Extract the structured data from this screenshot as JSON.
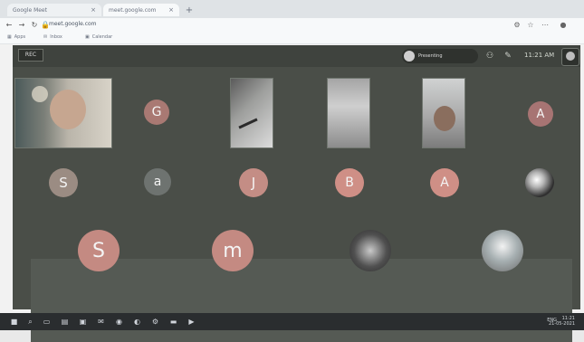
{
  "browser": {
    "tabs": [
      {
        "label": "Google Meet",
        "active": false
      },
      {
        "label": "meet.google.com",
        "active": true
      }
    ],
    "new_tab_icon": "plus-icon",
    "url": "meet.google.com",
    "bookmarks": [
      "Apps",
      "Inbox",
      "Calendar"
    ]
  },
  "meeting": {
    "rec_label": "REC",
    "presenter_label": "Presenting",
    "clock": "11:21 AM",
    "participants": [
      {
        "type": "video",
        "name": "",
        "row": 1
      },
      {
        "type": "avatar",
        "initial": "G",
        "color": "#a97973"
      },
      {
        "type": "video",
        "name": "",
        "row": 1
      },
      {
        "type": "video",
        "name": "",
        "row": 1
      },
      {
        "type": "video",
        "name": "",
        "row": 1
      },
      {
        "type": "avatar",
        "initial": "A",
        "color": "#a77473"
      },
      {
        "type": "avatar",
        "initial": "S",
        "color": "#9b8c83"
      },
      {
        "type": "avatar",
        "initial": "a",
        "color": "#6e7370"
      },
      {
        "type": "avatar",
        "initial": "J",
        "color": "#c48d85"
      },
      {
        "type": "avatar",
        "initial": "B",
        "color": "#cf8f86"
      },
      {
        "type": "avatar",
        "initial": "A",
        "color": "#cf8f86"
      },
      {
        "type": "photo",
        "initial": ""
      },
      {
        "type": "avatar",
        "initial": "S",
        "color": "#c48a82"
      },
      {
        "type": "avatar",
        "initial": "m",
        "color": "#c48a82"
      },
      {
        "type": "photo",
        "initial": ""
      },
      {
        "type": "photo",
        "initial": ""
      }
    ]
  },
  "taskbar": {
    "icons": [
      "windows-icon",
      "search-icon",
      "taskview-icon",
      "explorer-icon",
      "store-icon",
      "mail-icon",
      "chrome-icon",
      "edge-icon",
      "settings-icon",
      "folder-icon",
      "media-icon"
    ],
    "tray_text": "ENG",
    "time": "11:21",
    "date": "21-05-2021"
  }
}
